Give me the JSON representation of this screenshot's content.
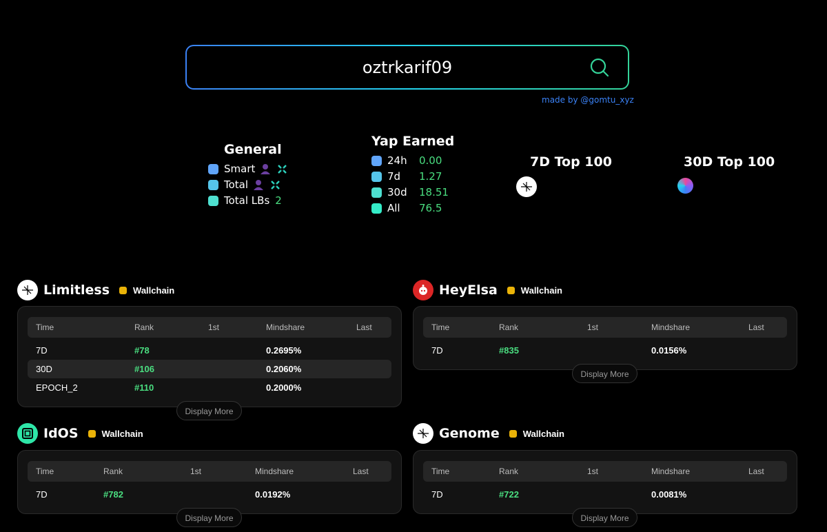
{
  "search": {
    "value": "oztrkarif09",
    "placeholder": ""
  },
  "credit": "made by @gomtu_xyz",
  "general": {
    "title": "General",
    "rows": [
      {
        "label": "Smart",
        "color": "#60a5fa"
      },
      {
        "label": "Total",
        "color": "#56c5ea"
      },
      {
        "label": "Total LBs",
        "value": "2",
        "color": "#4ee0d0"
      }
    ]
  },
  "yap": {
    "title": "Yap Earned",
    "rows": [
      {
        "label": "24h",
        "value": "0.00",
        "color": "#60a5fa"
      },
      {
        "label": "7d",
        "value": "1.27",
        "color": "#56c5ea"
      },
      {
        "label": "30d",
        "value": "18.51",
        "color": "#4ee0d0"
      },
      {
        "label": "All",
        "value": "76.5",
        "color": "#34ecc8"
      }
    ]
  },
  "top7d": {
    "title": "7D Top 100"
  },
  "top30d": {
    "title": "30D Top 100"
  },
  "table_headers": [
    "Time",
    "Rank",
    "1st",
    "Mindshare",
    "Last"
  ],
  "display_more": "Display More",
  "projects": [
    {
      "name": "Limitless",
      "badge": "Wallchain",
      "rows": [
        {
          "time": "7D",
          "rank": "#78",
          "mindshare": "0.2695%"
        },
        {
          "time": "30D",
          "rank": "#106",
          "mindshare": "0.2060%"
        },
        {
          "time": "EPOCH_2",
          "rank": "#110",
          "mindshare": "0.2000%"
        }
      ]
    },
    {
      "name": "HeyElsa",
      "badge": "Wallchain",
      "rows": [
        {
          "time": "7D",
          "rank": "#835",
          "mindshare": "0.0156%"
        }
      ]
    },
    {
      "name": "IdOS",
      "badge": "Wallchain",
      "rows": [
        {
          "time": "7D",
          "rank": "#782",
          "mindshare": "0.0192%"
        }
      ]
    },
    {
      "name": "Genome",
      "badge": "Wallchain",
      "rows": [
        {
          "time": "7D",
          "rank": "#722",
          "mindshare": "0.0081%"
        }
      ]
    }
  ],
  "colors": {
    "accent_green": "#4ade80",
    "badge_yellow": "#eab308",
    "link_blue": "#3b82f6"
  }
}
